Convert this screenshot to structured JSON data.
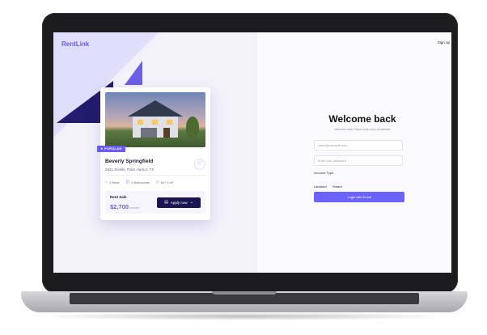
{
  "brand": {
    "logo_text": "RentLink",
    "accent_color": "#6a5cf0",
    "dark_color": "#231b6c"
  },
  "header": {
    "signup_label": "Sign up"
  },
  "property": {
    "badge": "POPULAR",
    "name": "Beverly Springfield",
    "address": "2821 Seville, Palm Harbor, TX",
    "specs": [
      {
        "icon": "bed-icon",
        "label": "4 Beds"
      },
      {
        "icon": "bath-icon",
        "label": "2 Bathrooms"
      },
      {
        "icon": "area-icon",
        "label": "6x7.5 m²"
      }
    ],
    "rent_label": "Rent Sale",
    "price": "$2,700",
    "price_period": "/month",
    "apply_label": "Apply now"
  },
  "login": {
    "title": "Welcome back",
    "subtitle": "Welcome back Please enter your credentials",
    "email_placeholder": "name@example.com",
    "password_placeholder": "Enter your password",
    "account_type_label": "Account Type",
    "account_types": [
      "Landlord",
      "Tenant"
    ],
    "submit_label": "Login with Email"
  }
}
